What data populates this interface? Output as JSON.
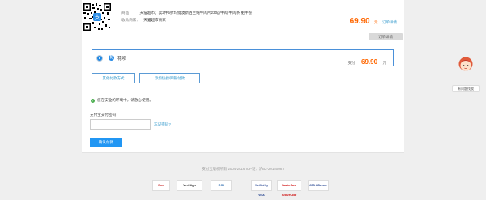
{
  "order": {
    "merchant_key": "商品：",
    "product_title": "【天猫超市】卖2件5折玛缇澳新西兰纯牛肉片230g 牛肉 牛肉条 肥牛卷",
    "merchant2_key": "收款商家：",
    "merchant_name": "天猫超市商家",
    "price": "69.90",
    "price_unit": "元",
    "order_detail_link": "订单详情"
  },
  "buttons": {
    "order_details": "订单详情"
  },
  "payment": {
    "method_label": "花呗",
    "pay_label": "支付",
    "amount": "69.90",
    "unit": "元",
    "other_methods": "其他付款方式",
    "add_card": "添加快捷/网银付款"
  },
  "security": {
    "message": "您在安全的环境中，请放心使用。"
  },
  "password": {
    "label": "支付宝支付密码：",
    "placeholder": "",
    "forgot": "忘记密码?"
  },
  "confirm": {
    "label": "确认付款"
  },
  "footer": {
    "copyright": "支付宝版权所有 2004-2016 ICP证：沪B2-20150087"
  },
  "badges": [
    "Bao",
    "VeriSign",
    "PCI",
    "Verified by VISA",
    "MasterCard SecureCode",
    "JCB J/Secure"
  ],
  "assistant": {
    "label": "有问题找我"
  },
  "colors": {
    "accent": "#ff6600",
    "link": "#3399cc",
    "primary": "#2196f3",
    "success": "#4caf50"
  }
}
